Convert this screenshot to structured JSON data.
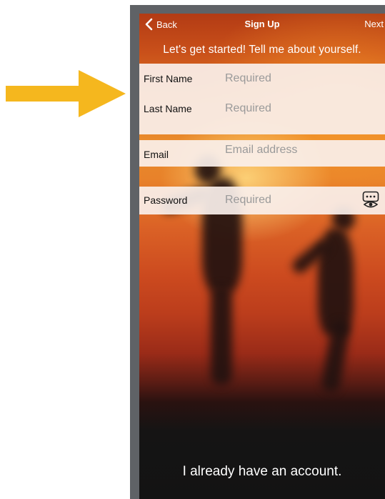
{
  "navbar": {
    "back_label": "Back",
    "title": "Sign Up",
    "next_label": "Next",
    "back_icon": "chevron-left-icon"
  },
  "intro_text": "Let's get started! Tell me about yourself.",
  "fields": {
    "first_name": {
      "label": "First Name",
      "placeholder": "Required",
      "value": ""
    },
    "last_name": {
      "label": "Last Name",
      "placeholder": "Required",
      "value": ""
    },
    "email": {
      "label": "Email",
      "placeholder": "Email address",
      "value": ""
    },
    "password": {
      "label": "Password",
      "placeholder": "Required",
      "value": "",
      "toggle_icon": "show-password-eye-icon"
    }
  },
  "account_link": "I already have an account.",
  "colors": {
    "arrow": "#f5b71e",
    "frame": "#5f6266",
    "field_background": "#faf0ec",
    "text_white": "#ffffff"
  }
}
